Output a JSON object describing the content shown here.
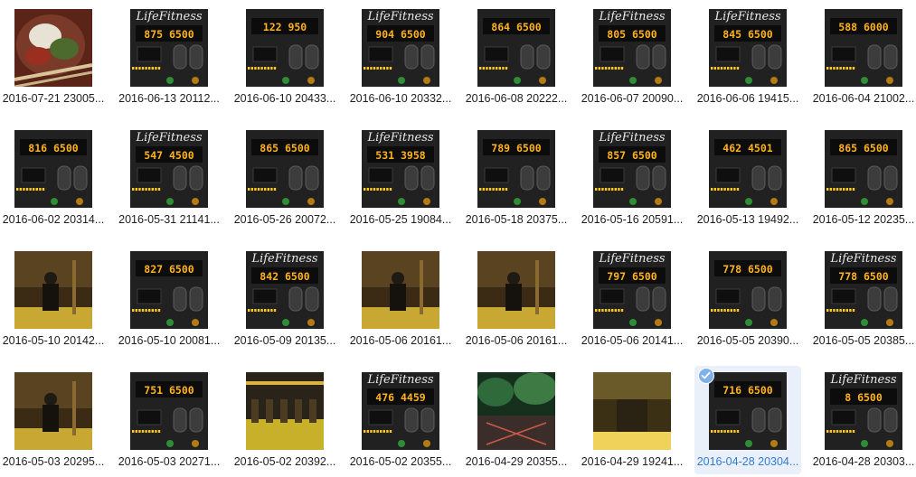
{
  "accent_color": "#2f7bd8",
  "photos": [
    {
      "name": "2016-07-21 23005...",
      "kind": "food"
    },
    {
      "name": "2016-06-13 20112...",
      "kind": "panel",
      "display": "875 6500",
      "logo": "LifeFitness"
    },
    {
      "name": "2016-06-10 20433...",
      "kind": "panel",
      "display": "122 950"
    },
    {
      "name": "2016-06-10 20332...",
      "kind": "panel",
      "display": "904 6500",
      "logo": "LifeFitness"
    },
    {
      "name": "2016-06-08 20222...",
      "kind": "panel",
      "display": "864 6500"
    },
    {
      "name": "2016-06-07 20090...",
      "kind": "panel",
      "display": "805 6500",
      "logo": "LifeFitness"
    },
    {
      "name": "2016-06-06 19415...",
      "kind": "panel",
      "display": "845 6500",
      "logo": "LifeFitness"
    },
    {
      "name": "2016-06-04 21002...",
      "kind": "panel",
      "display": "588 6000"
    },
    {
      "name": "2016-06-02 20314...",
      "kind": "panel",
      "display": "816 6500"
    },
    {
      "name": "2016-05-31 21141...",
      "kind": "panel",
      "display": "547 4500",
      "logo": "LifeFitness"
    },
    {
      "name": "2016-05-26 20072...",
      "kind": "panel",
      "display": "865 6500"
    },
    {
      "name": "2016-05-25 19084...",
      "kind": "panel",
      "display": "531 3958",
      "logo": "LifeFitness"
    },
    {
      "name": "2016-05-18 20375...",
      "kind": "panel",
      "display": "789 6500"
    },
    {
      "name": "2016-05-16 20591...",
      "kind": "panel",
      "display": "857 6500",
      "logo": "LifeFitness"
    },
    {
      "name": "2016-05-13 19492...",
      "kind": "panel",
      "display": "462 4501"
    },
    {
      "name": "2016-05-12 20235...",
      "kind": "panel",
      "display": "865 6500"
    },
    {
      "name": "2016-05-10 20142...",
      "kind": "gym_person"
    },
    {
      "name": "2016-05-10 20081...",
      "kind": "panel",
      "display": "827 6500"
    },
    {
      "name": "2016-05-09 20135...",
      "kind": "panel",
      "display": "842 6500",
      "logo": "LifeFitness"
    },
    {
      "name": "2016-05-06 20161...",
      "kind": "gym_person"
    },
    {
      "name": "2016-05-06 20161...",
      "kind": "gym_person"
    },
    {
      "name": "2016-05-06 20141...",
      "kind": "panel",
      "display": "797 6500",
      "logo": "LifeFitness"
    },
    {
      "name": "2016-05-05 20390...",
      "kind": "panel",
      "display": "778 6500"
    },
    {
      "name": "2016-05-05 20385...",
      "kind": "panel",
      "display": "778 6500",
      "logo": "LifeFitness"
    },
    {
      "name": "2016-05-03 20295...",
      "kind": "gym_person"
    },
    {
      "name": "2016-05-03 20271...",
      "kind": "panel",
      "display": "751 6500"
    },
    {
      "name": "2016-05-02 20392...",
      "kind": "gym_room"
    },
    {
      "name": "2016-05-02 20355...",
      "kind": "panel",
      "display": "476 4459",
      "logo": "LifeFitness"
    },
    {
      "name": "2016-04-29 20355...",
      "kind": "green_room"
    },
    {
      "name": "2016-04-29 19241...",
      "kind": "gym_dark"
    },
    {
      "name": "2016-04-28 20304...",
      "kind": "panel",
      "display": "716 6500",
      "selected": true
    },
    {
      "name": "2016-04-28 20303...",
      "kind": "panel",
      "display": "8 6500",
      "logo": "LifeFitness"
    }
  ]
}
